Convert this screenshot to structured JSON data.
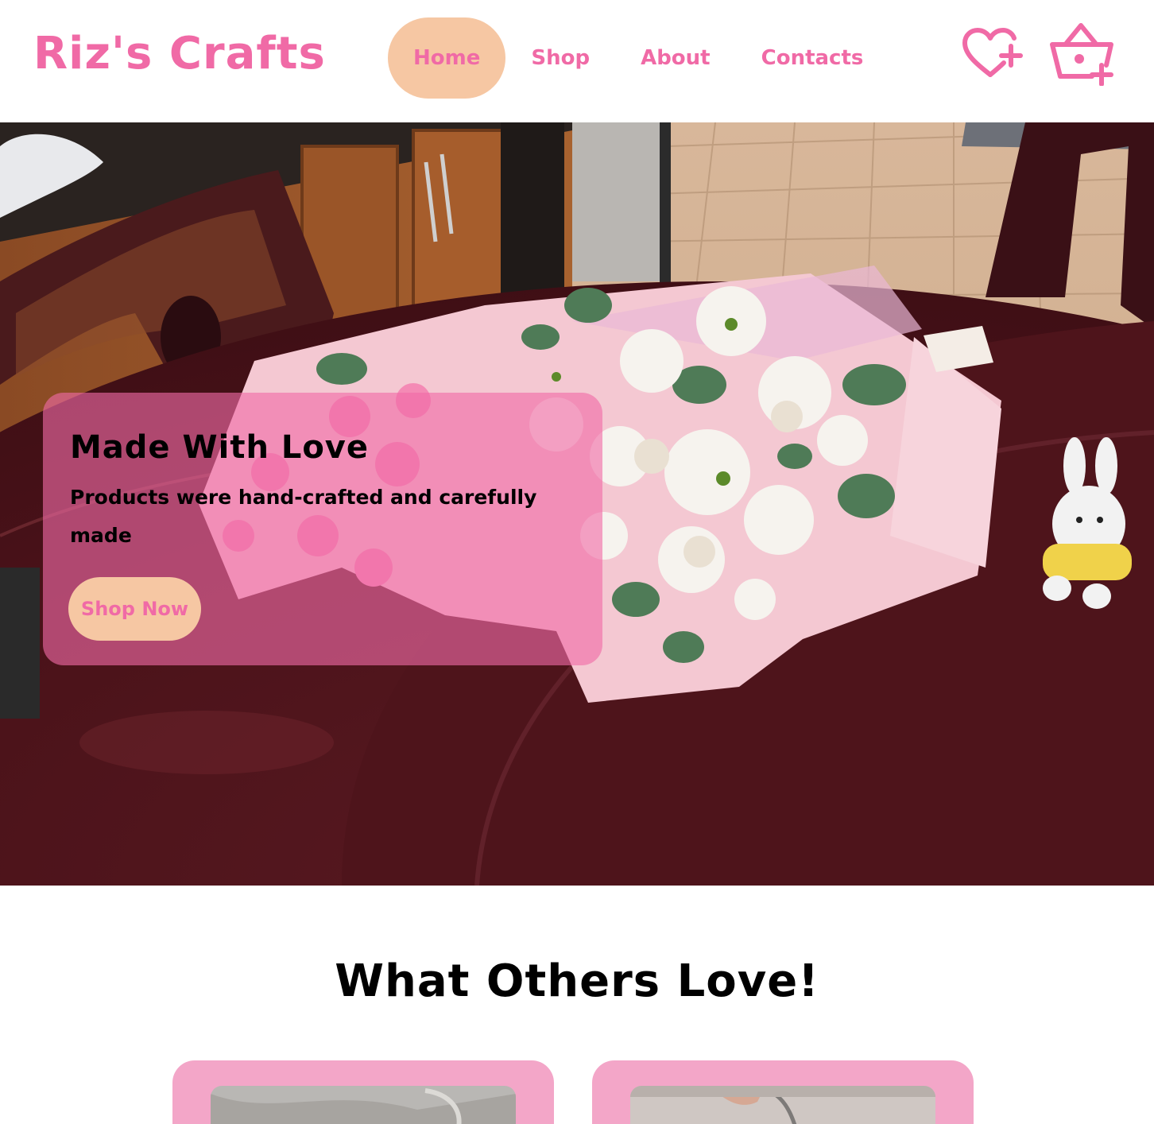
{
  "brand": {
    "name": "Riz's Crafts"
  },
  "nav": {
    "home": "Home",
    "shop": "Shop",
    "about": "About",
    "contacts": "Contacts",
    "active": "Home"
  },
  "icons": {
    "wishlist": "heart-plus-icon",
    "cart": "basket-plus-icon"
  },
  "hero": {
    "title": "Made With Love",
    "subtitle": "Products were hand-crafted and carefully made",
    "button": "Shop Now",
    "image": "bouquet-on-table-photo"
  },
  "love": {
    "title": "What Others Love!"
  },
  "colors": {
    "accent": "#f06aa6",
    "peach": "#f6c7a3",
    "card": "#f3a6c8"
  }
}
